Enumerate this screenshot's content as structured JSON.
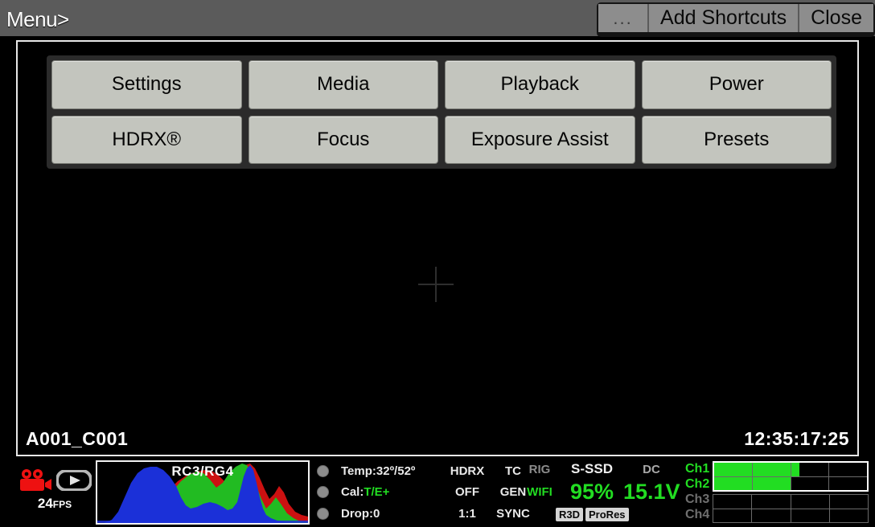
{
  "topbar": {
    "menu_label": "Menu>",
    "buttons": [
      {
        "name": "more-options",
        "label": "..."
      },
      {
        "name": "add-shortcuts",
        "label": "Add Shortcuts"
      },
      {
        "name": "close",
        "label": "Close"
      }
    ]
  },
  "shortcut_menu": {
    "buttons": [
      {
        "name": "settings",
        "label": "Settings"
      },
      {
        "name": "media",
        "label": "Media"
      },
      {
        "name": "playback",
        "label": "Playback"
      },
      {
        "name": "power",
        "label": "Power"
      },
      {
        "name": "hdrx",
        "label": "HDRX®"
      },
      {
        "name": "focus",
        "label": "Focus"
      },
      {
        "name": "exposure-assist",
        "label": "Exposure Assist"
      },
      {
        "name": "presets",
        "label": "Presets"
      }
    ]
  },
  "viewport": {
    "clip_name": "A001_C001",
    "timecode": "12:35:17:25"
  },
  "statusbar": {
    "record": {
      "fps_value": "24",
      "fps_unit": "FPS",
      "camera_icon_color": "#ee1111",
      "play_icon_color": "#b6b6b6"
    },
    "histogram": {
      "label": "RC3/RG4"
    },
    "metrics": {
      "temp_label": "Temp:",
      "temp_value": "32º/52º",
      "cal_label": "Cal:",
      "cal_value": "T/E+",
      "drop_label": "Drop:",
      "drop_value": "0",
      "hdrx": "HDRX",
      "hdrx_state": "OFF",
      "hdrx_ratio": "1:1",
      "tc": "TC",
      "tc_gen": "GEN",
      "tc_sync": "SYNC"
    },
    "connectivity": {
      "rig": "RIG",
      "wifi": "WIFI",
      "ssd_label": "S-SSD",
      "ssd_value": "95%",
      "dc_label": "DC",
      "dc_value": "15.1V",
      "codec_badges": [
        "R3D",
        "ProRes"
      ]
    },
    "audio": {
      "channels": [
        {
          "label": "Ch1",
          "active": true,
          "level": 56
        },
        {
          "label": "Ch2",
          "active": true,
          "level": 50
        },
        {
          "label": "Ch3",
          "active": false,
          "level": 0
        },
        {
          "label": "Ch4",
          "active": false,
          "level": 0
        }
      ]
    }
  },
  "colors": {
    "accent_green": "#22dd22",
    "record_red": "#ee1111",
    "panel_gray": "#2b2b2b",
    "button_gray": "#c3c5be",
    "topbar_gray": "#5b5b5b"
  }
}
